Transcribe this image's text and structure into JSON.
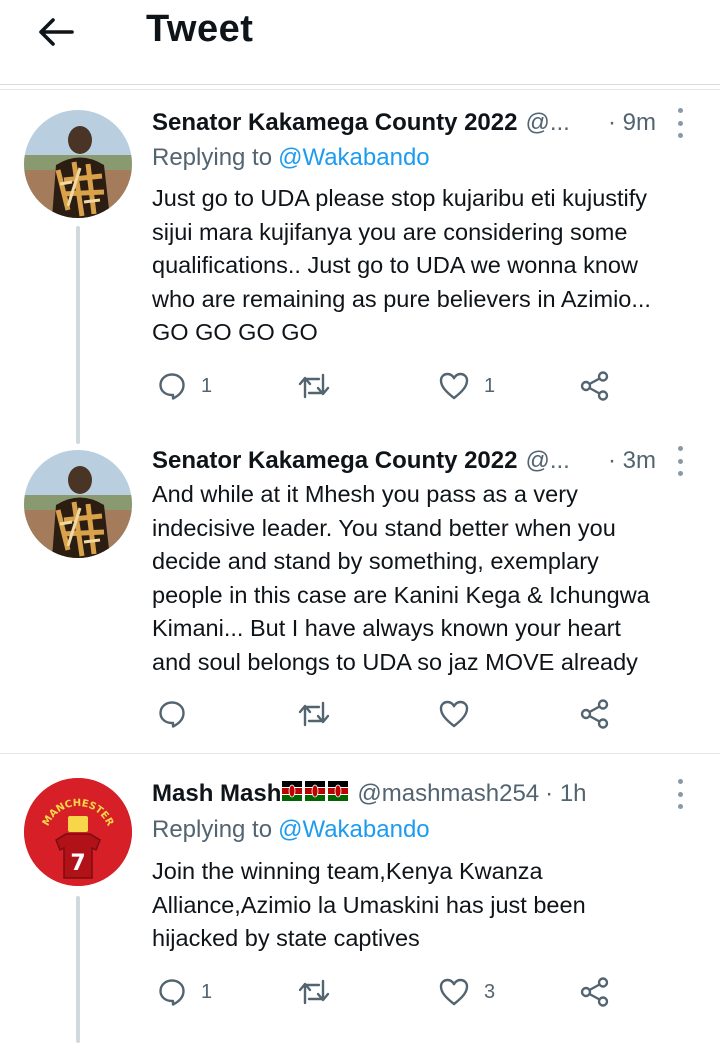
{
  "header": {
    "title": "Tweet",
    "back_icon": "arrow-left-icon"
  },
  "tweets": [
    {
      "name": "Senator Kakamega County 2022",
      "handle": "@...",
      "time": "· 9m",
      "replying_label": "Replying to",
      "replying_to": "@Wakabando",
      "text": "Just go to UDA please stop kujaribu eti kujustify\nsijui mara kujifanya you are considering some\nqualifications.. Just go to UDA we wonna know\nwho are remaining as pure believers in Azimio...\nGO GO GO GO",
      "replies": "1",
      "retweets": "",
      "likes": "1"
    },
    {
      "name": "Senator Kakamega County 2022",
      "handle": "@...",
      "time": "· 3m",
      "text": "And while at it Mhesh you pass as a very\nindecisive leader. You stand better when you\ndecide and stand by something, exemplary\npeople in this case are Kanini Kega & Ichungwa\nKimani... But I have always known your heart\nand soul belongs to UDA so jaz MOVE already",
      "replies": "",
      "retweets": "",
      "likes": ""
    },
    {
      "name": "Mash Mash",
      "handle": "@mashmash254",
      "time": "· 1h",
      "replying_label": "Replying to",
      "replying_to": "@Wakabando",
      "text": "Join the winning team,Kenya Kwanza\nAlliance,Azimio la Umaskini has just been\nhijacked by state captives",
      "replies": "1",
      "retweets": "",
      "likes": "3",
      "avatar_text": "MANCHESTER",
      "jersey_number": "7"
    }
  ],
  "colors": {
    "accent": "#1d9bf0",
    "muted": "#536471",
    "text": "#0f1419",
    "divider": "#e6e9ec"
  }
}
